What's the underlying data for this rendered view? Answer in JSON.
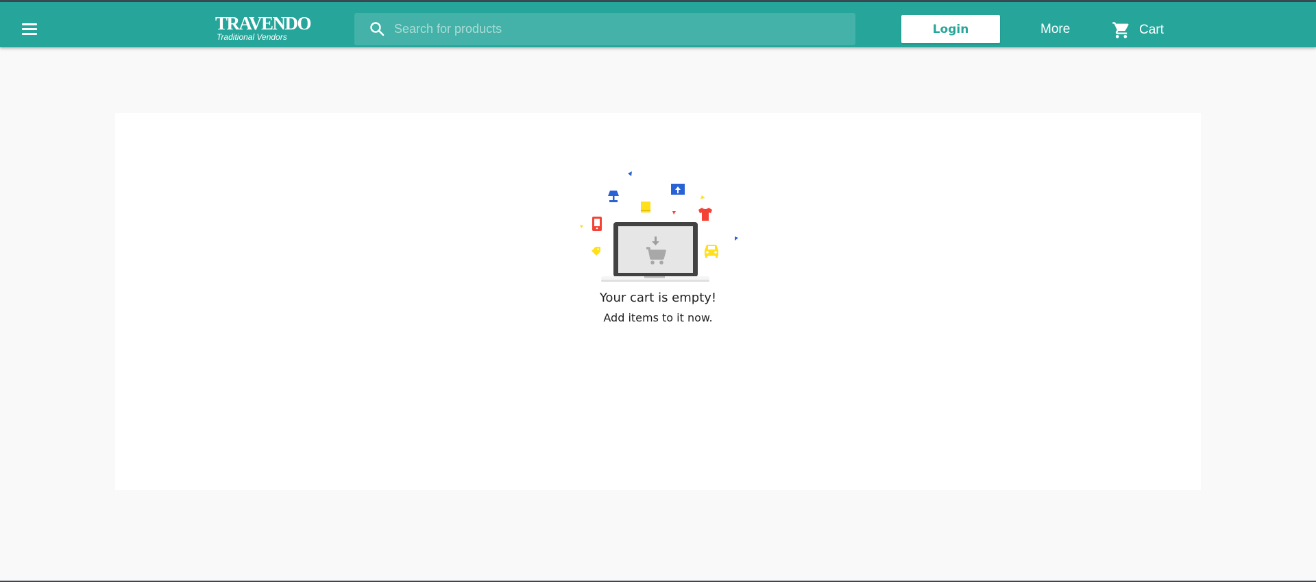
{
  "header": {
    "logo": {
      "main": "TRAVENDO",
      "sub": "Traditional Vendors"
    },
    "search": {
      "placeholder": "Search for products",
      "value": ""
    },
    "login_label": "Login",
    "more_label": "More",
    "cart_label": "Cart"
  },
  "cart": {
    "empty_title": "Your cart is empty!",
    "empty_subtitle": "Add items to it now."
  },
  "colors": {
    "brand": "#26a69a",
    "illustration_red": "#f44336",
    "illustration_blue": "#2962d4",
    "illustration_yellow": "#ffe01b"
  },
  "icons": [
    "menu-icon",
    "search-icon",
    "cart-icon",
    "empty-cart-illustration"
  ]
}
